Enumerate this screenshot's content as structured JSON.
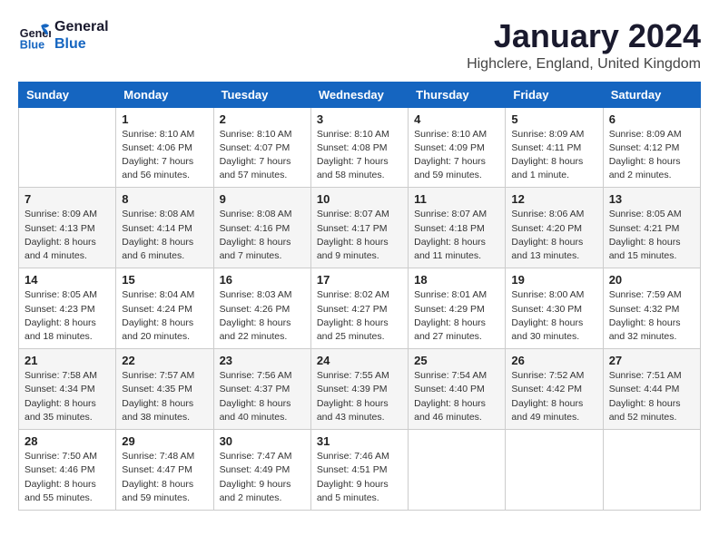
{
  "logo": {
    "line1": "General",
    "line2": "Blue"
  },
  "title": "January 2024",
  "subtitle": "Highclere, England, United Kingdom",
  "days_of_week": [
    "Sunday",
    "Monday",
    "Tuesday",
    "Wednesday",
    "Thursday",
    "Friday",
    "Saturday"
  ],
  "weeks": [
    [
      {
        "day": "",
        "info": ""
      },
      {
        "day": "1",
        "info": "Sunrise: 8:10 AM\nSunset: 4:06 PM\nDaylight: 7 hours\nand 56 minutes."
      },
      {
        "day": "2",
        "info": "Sunrise: 8:10 AM\nSunset: 4:07 PM\nDaylight: 7 hours\nand 57 minutes."
      },
      {
        "day": "3",
        "info": "Sunrise: 8:10 AM\nSunset: 4:08 PM\nDaylight: 7 hours\nand 58 minutes."
      },
      {
        "day": "4",
        "info": "Sunrise: 8:10 AM\nSunset: 4:09 PM\nDaylight: 7 hours\nand 59 minutes."
      },
      {
        "day": "5",
        "info": "Sunrise: 8:09 AM\nSunset: 4:11 PM\nDaylight: 8 hours\nand 1 minute."
      },
      {
        "day": "6",
        "info": "Sunrise: 8:09 AM\nSunset: 4:12 PM\nDaylight: 8 hours\nand 2 minutes."
      }
    ],
    [
      {
        "day": "7",
        "info": "Sunrise: 8:09 AM\nSunset: 4:13 PM\nDaylight: 8 hours\nand 4 minutes."
      },
      {
        "day": "8",
        "info": "Sunrise: 8:08 AM\nSunset: 4:14 PM\nDaylight: 8 hours\nand 6 minutes."
      },
      {
        "day": "9",
        "info": "Sunrise: 8:08 AM\nSunset: 4:16 PM\nDaylight: 8 hours\nand 7 minutes."
      },
      {
        "day": "10",
        "info": "Sunrise: 8:07 AM\nSunset: 4:17 PM\nDaylight: 8 hours\nand 9 minutes."
      },
      {
        "day": "11",
        "info": "Sunrise: 8:07 AM\nSunset: 4:18 PM\nDaylight: 8 hours\nand 11 minutes."
      },
      {
        "day": "12",
        "info": "Sunrise: 8:06 AM\nSunset: 4:20 PM\nDaylight: 8 hours\nand 13 minutes."
      },
      {
        "day": "13",
        "info": "Sunrise: 8:05 AM\nSunset: 4:21 PM\nDaylight: 8 hours\nand 15 minutes."
      }
    ],
    [
      {
        "day": "14",
        "info": "Sunrise: 8:05 AM\nSunset: 4:23 PM\nDaylight: 8 hours\nand 18 minutes."
      },
      {
        "day": "15",
        "info": "Sunrise: 8:04 AM\nSunset: 4:24 PM\nDaylight: 8 hours\nand 20 minutes."
      },
      {
        "day": "16",
        "info": "Sunrise: 8:03 AM\nSunset: 4:26 PM\nDaylight: 8 hours\nand 22 minutes."
      },
      {
        "day": "17",
        "info": "Sunrise: 8:02 AM\nSunset: 4:27 PM\nDaylight: 8 hours\nand 25 minutes."
      },
      {
        "day": "18",
        "info": "Sunrise: 8:01 AM\nSunset: 4:29 PM\nDaylight: 8 hours\nand 27 minutes."
      },
      {
        "day": "19",
        "info": "Sunrise: 8:00 AM\nSunset: 4:30 PM\nDaylight: 8 hours\nand 30 minutes."
      },
      {
        "day": "20",
        "info": "Sunrise: 7:59 AM\nSunset: 4:32 PM\nDaylight: 8 hours\nand 32 minutes."
      }
    ],
    [
      {
        "day": "21",
        "info": "Sunrise: 7:58 AM\nSunset: 4:34 PM\nDaylight: 8 hours\nand 35 minutes."
      },
      {
        "day": "22",
        "info": "Sunrise: 7:57 AM\nSunset: 4:35 PM\nDaylight: 8 hours\nand 38 minutes."
      },
      {
        "day": "23",
        "info": "Sunrise: 7:56 AM\nSunset: 4:37 PM\nDaylight: 8 hours\nand 40 minutes."
      },
      {
        "day": "24",
        "info": "Sunrise: 7:55 AM\nSunset: 4:39 PM\nDaylight: 8 hours\nand 43 minutes."
      },
      {
        "day": "25",
        "info": "Sunrise: 7:54 AM\nSunset: 4:40 PM\nDaylight: 8 hours\nand 46 minutes."
      },
      {
        "day": "26",
        "info": "Sunrise: 7:52 AM\nSunset: 4:42 PM\nDaylight: 8 hours\nand 49 minutes."
      },
      {
        "day": "27",
        "info": "Sunrise: 7:51 AM\nSunset: 4:44 PM\nDaylight: 8 hours\nand 52 minutes."
      }
    ],
    [
      {
        "day": "28",
        "info": "Sunrise: 7:50 AM\nSunset: 4:46 PM\nDaylight: 8 hours\nand 55 minutes."
      },
      {
        "day": "29",
        "info": "Sunrise: 7:48 AM\nSunset: 4:47 PM\nDaylight: 8 hours\nand 59 minutes."
      },
      {
        "day": "30",
        "info": "Sunrise: 7:47 AM\nSunset: 4:49 PM\nDaylight: 9 hours\nand 2 minutes."
      },
      {
        "day": "31",
        "info": "Sunrise: 7:46 AM\nSunset: 4:51 PM\nDaylight: 9 hours\nand 5 minutes."
      },
      {
        "day": "",
        "info": ""
      },
      {
        "day": "",
        "info": ""
      },
      {
        "day": "",
        "info": ""
      }
    ]
  ]
}
